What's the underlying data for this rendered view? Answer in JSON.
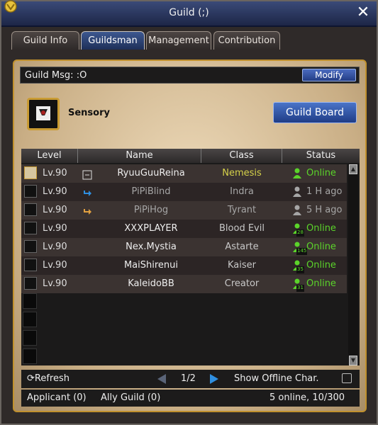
{
  "window": {
    "title": "Guild (;)"
  },
  "tabs": [
    {
      "label": "Guild Info"
    },
    {
      "label": "Guildsman"
    },
    {
      "label": "Management"
    },
    {
      "label": "Contribution"
    }
  ],
  "guild": {
    "msg_label": "Guild Msg:",
    "msg_value": ":O",
    "modify_label": "Modify",
    "name": "Sensory",
    "board_label": "Guild Board"
  },
  "table": {
    "headers": [
      "Level",
      "Name",
      "Class",
      "Status"
    ],
    "rows": [
      {
        "level": "Lv.90",
        "name": "RyuuGuuReina",
        "class": "Nemesis",
        "status": "Online",
        "online": true,
        "rank_icon": "master-icon"
      },
      {
        "level": "Lv.90",
        "name": "PiPiBlind",
        "class": "Indra",
        "status": "1 H ago",
        "online": false,
        "rank_icon": "arrow-right-blue-icon"
      },
      {
        "level": "Lv.90",
        "name": "PiPiHog",
        "class": "Tyrant",
        "status": "5 H ago",
        "online": false,
        "rank_icon": "arrow-right-orange-icon"
      },
      {
        "level": "Lv.90",
        "name": "XXXPLAYER",
        "class": "Blood  Evil",
        "status": "Online",
        "online": true,
        "badge": "28"
      },
      {
        "level": "Lv.90",
        "name": "Nex.Mystia",
        "class": "Astarte",
        "status": "Online",
        "online": true,
        "badge": "145"
      },
      {
        "level": "Lv.90",
        "name": "MaiShirenui",
        "class": "Kaiser",
        "status": "Online",
        "online": true,
        "badge": "35"
      },
      {
        "level": "Lv.90",
        "name": "KaleidoBB",
        "class": "Creator",
        "status": "Online",
        "online": true,
        "badge": "31"
      }
    ]
  },
  "pagination": {
    "refresh_label": "Refresh",
    "page": "1/2",
    "offline_label": "Show  Offline  Char."
  },
  "footer": {
    "applicant": "Applicant  (0)",
    "ally": "Ally  Guild  (0)",
    "summary": "5  online,  10/300"
  },
  "colors": {
    "online": "#5bd42a",
    "offline": "#a6a6a6",
    "accent": "#c1912e",
    "button": "#2a4a9a"
  }
}
